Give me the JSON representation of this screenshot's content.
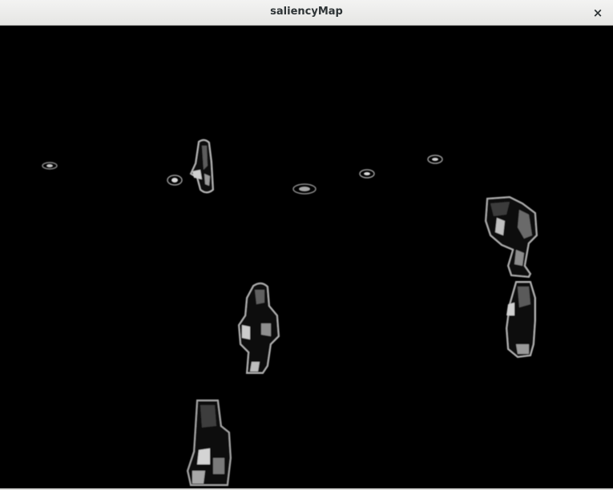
{
  "window": {
    "title": "saliencyMap",
    "close_glyph": "×",
    "close_icon": "close-icon"
  },
  "image": {
    "description_colors": {
      "background": "#000000",
      "highlight": "#d0d0d0",
      "mid": "#6e6e6e"
    }
  }
}
